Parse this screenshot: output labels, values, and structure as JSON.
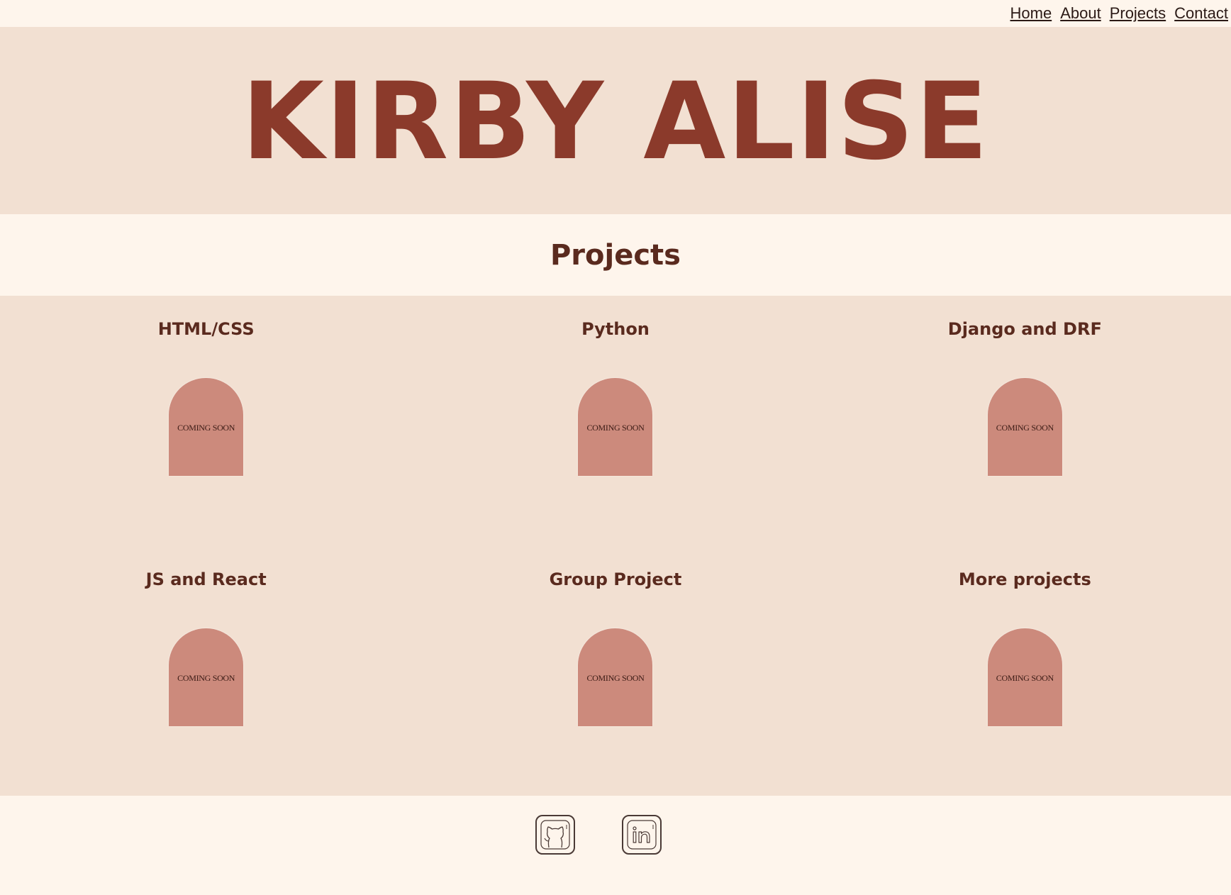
{
  "nav": {
    "links": [
      "Home",
      "About",
      "Projects",
      "Contact"
    ]
  },
  "hero": {
    "title": "KIRBY ALISE"
  },
  "projects_section": {
    "title": "Projects",
    "items": [
      {
        "title": "HTML/CSS",
        "badge": "COMING SOON"
      },
      {
        "title": "Python",
        "badge": "COMING SOON"
      },
      {
        "title": "Django and DRF",
        "badge": "COMING SOON"
      },
      {
        "title": "JS and React",
        "badge": "COMING SOON"
      },
      {
        "title": "Group Project",
        "badge": "COMING SOON"
      },
      {
        "title": "More projects",
        "badge": "COMING SOON"
      }
    ]
  },
  "footer": {
    "social": [
      {
        "icon": "github-icon"
      },
      {
        "icon": "linkedin-icon"
      }
    ]
  },
  "colors": {
    "accent": "#8b3a2b",
    "text": "#5a2a1e",
    "band": "#f2e0d2",
    "background": "#fef5ec",
    "arch": "#cc8a7c"
  }
}
